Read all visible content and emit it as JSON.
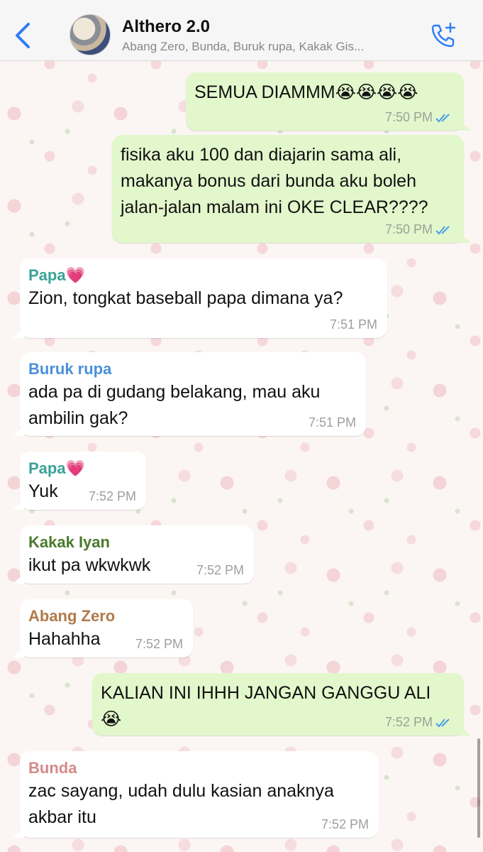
{
  "header": {
    "title": "Althero 2.0",
    "subtitle": "Abang Zero, Bunda, Buruk rupa, Kakak Gis...",
    "colors": {
      "accent": "#2f7cf6",
      "header_bg": "#f6f6f6"
    }
  },
  "messages": [
    {
      "direction": "out",
      "text": "SEMUA DIAMMM😭😭😭😭",
      "time": "7:50 PM",
      "status": "read"
    },
    {
      "direction": "out",
      "text": "fisika aku 100 dan diajarin sama ali, makanya bonus dari bunda aku boleh jalan-jalan malam ini OKE CLEAR????",
      "time": "7:50 PM",
      "status": "read"
    },
    {
      "direction": "in",
      "sender": "Papa💗",
      "sender_color": "#3aa297",
      "text": "Zion, tongkat baseball papa dimana ya?",
      "time": "7:51 PM"
    },
    {
      "direction": "in",
      "sender": "Buruk rupa",
      "sender_color": "#4a90d9",
      "text": "ada pa di gudang belakang, mau aku ambilin gak?",
      "time": "7:51 PM"
    },
    {
      "direction": "in",
      "sender": "Papa💗",
      "sender_color": "#3aa297",
      "text": "Yuk",
      "time": "7:52 PM"
    },
    {
      "direction": "in",
      "sender": "Kakak Iyan",
      "sender_color": "#4a7a2c",
      "text": "ikut pa wkwkwk",
      "time": "7:52 PM"
    },
    {
      "direction": "in",
      "sender": "Abang Zero",
      "sender_color": "#b07a4a",
      "text": "Hahahha",
      "time": "7:52 PM"
    },
    {
      "direction": "out",
      "text": "KALIAN INI IHHH JANGAN GANGGU ALI😭",
      "time": "7:52 PM",
      "status": "read"
    },
    {
      "direction": "in",
      "sender": "Bunda",
      "sender_color": "#d48a8a",
      "text": "zac sayang, udah dulu kasian anaknya akbar itu",
      "time": "7:52 PM"
    }
  ],
  "icons": {
    "back": "chevron-left-icon",
    "call": "add-call-icon",
    "read": "double-check-icon"
  }
}
